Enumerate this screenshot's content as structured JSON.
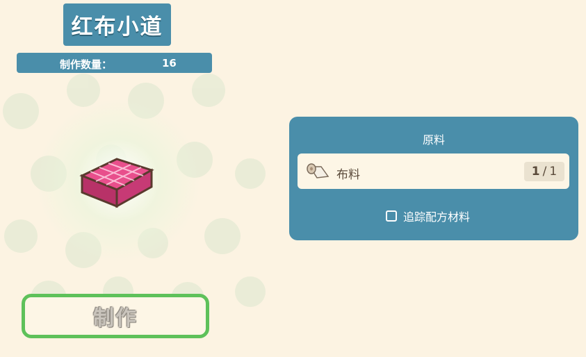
{
  "recipe": {
    "title": "红布小道",
    "quantity_label": "制作数量：",
    "quantity_value": "16",
    "item_icon": "red-cloth-path-icon"
  },
  "craft_button": {
    "label": "制作"
  },
  "materials": {
    "title": "原料",
    "items": [
      {
        "icon": "cloth-roll-icon",
        "name": "布料",
        "have": "1",
        "separator": "/",
        "need": "1"
      }
    ],
    "track_label": "追踪配方材料",
    "track_checked": false
  },
  "colors": {
    "panel": "#4a8eaa",
    "background": "#fcf3e2",
    "button_border": "#5ec15a"
  }
}
